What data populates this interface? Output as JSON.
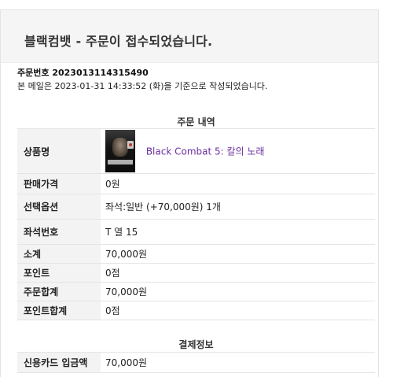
{
  "header": {
    "title": "블랙컴뱃 - 주문이 접수되었습니다."
  },
  "order": {
    "number_label": "주문번호",
    "number": "2023013114315490",
    "date_text": "본 메일은 2023-01-31 14:33:52 (화)을 기준으로 작성되었습니다."
  },
  "order_details": {
    "title": "주문 내역",
    "rows": [
      {
        "label": "상품명",
        "value": "Black Combat 5: 칼의 노래"
      },
      {
        "label": "판매가격",
        "value": "0원"
      },
      {
        "label": "선택옵션",
        "value": "좌석:일반 (+70,000원) 1개"
      },
      {
        "label": "좌석번호",
        "value": "T 열 15"
      },
      {
        "label": "소계",
        "value": "70,000원"
      },
      {
        "label": "포인트",
        "value": "0점"
      },
      {
        "label": "주문합계",
        "value": "70,000원"
      },
      {
        "label": "포인트합계",
        "value": "0점"
      }
    ]
  },
  "payment": {
    "title": "결제정보",
    "rows": [
      {
        "label": "신용카드 입금액",
        "value": "70,000원"
      }
    ]
  },
  "colors": {
    "link": "#6b2fa0",
    "label_bg": "#f3f3f3",
    "header_bg": "#f5f5f5"
  },
  "icons": {
    "product_thumbnail": "event-poster-image"
  }
}
